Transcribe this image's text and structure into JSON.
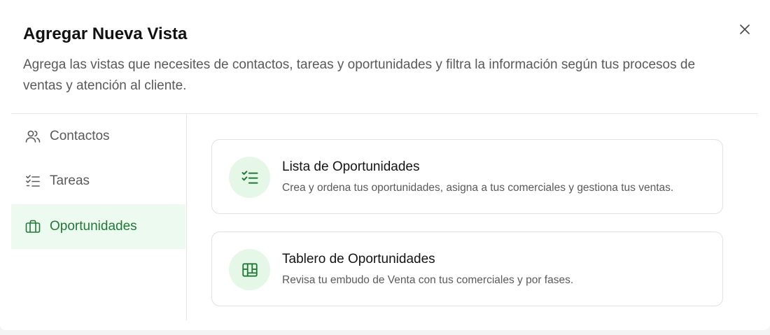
{
  "dialog": {
    "title": "Agregar Nueva Vista",
    "subtitle": "Agrega las vistas que necesites de contactos, tareas y oportunidades y filtra la información según tus procesos de ventas y atención al cliente.",
    "close_icon": "close-icon"
  },
  "sidebar": {
    "items": [
      {
        "label": "Contactos",
        "icon": "users-icon",
        "active": false
      },
      {
        "label": "Tareas",
        "icon": "checklist-icon",
        "active": false
      },
      {
        "label": "Oportunidades",
        "icon": "briefcase-icon",
        "active": true
      }
    ]
  },
  "views": [
    {
      "title": "Lista de Oportunidades",
      "description": "Crea y ordena tus oportunidades, asigna a tus comerciales y gestiona tus ventas.",
      "icon": "checklist-icon"
    },
    {
      "title": "Tablero de Oportunidades",
      "description": "Revisa tu embudo de Venta con tus comerciales y por fases.",
      "icon": "board-icon"
    }
  ],
  "colors": {
    "accent": "#1e7a34",
    "active_bg": "#ecfaef",
    "badge_bg": "#e5f8e8"
  }
}
